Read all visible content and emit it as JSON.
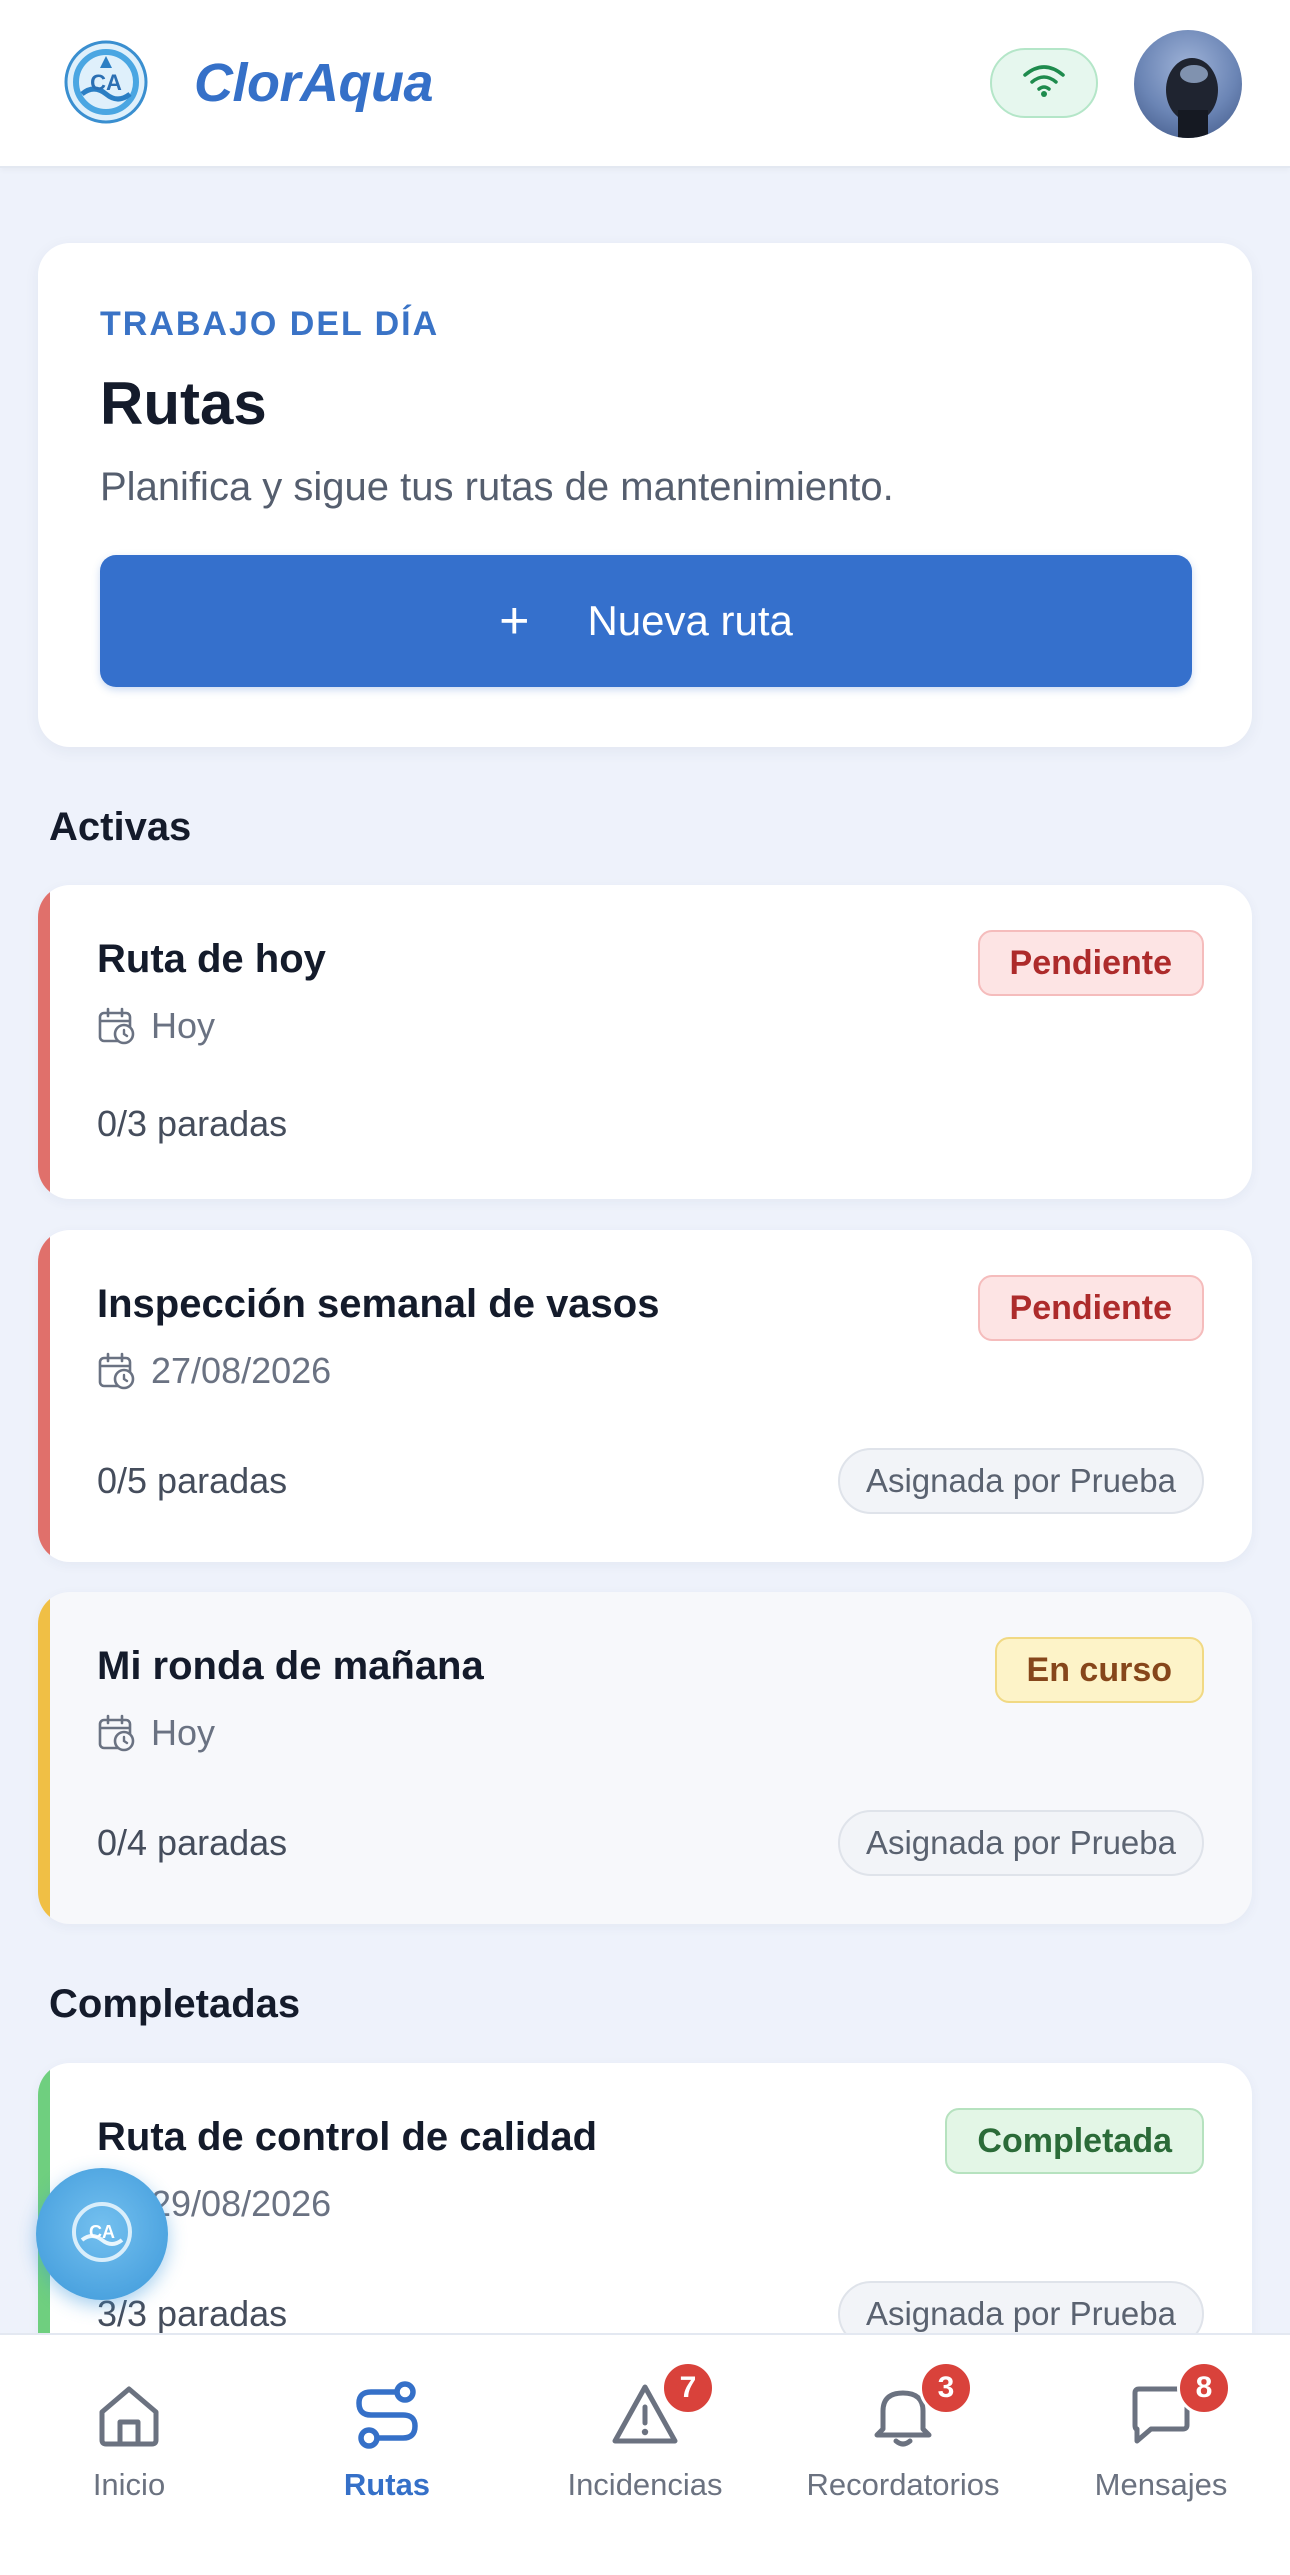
{
  "header": {
    "brand": "ClorAqua",
    "logo_icon": "cloraqua-logo-icon",
    "status_icon": "wifi-icon",
    "status_color": "#1e8b4d"
  },
  "hero": {
    "eyebrow": "TRABAJO DEL DÍA",
    "title": "Rutas",
    "subtitle": "Planifica y sigue tus rutas de mantenimiento.",
    "new_button": {
      "icon": "+",
      "label": "Nueva ruta"
    }
  },
  "sections": {
    "active": "Activas",
    "completed": "Completadas"
  },
  "routes": [
    {
      "title": "Ruta de hoy",
      "date": "Hoy",
      "stops": "0/3 paradas",
      "status": "Pendiente",
      "assigned": "",
      "accent": "#e0706b"
    },
    {
      "title": "Inspección semanal de vasos",
      "date": "27/08/2026",
      "stops": "0/5 paradas",
      "status": "Pendiente",
      "assigned": "Asignada por Prueba",
      "accent": "#e0706b"
    },
    {
      "title": "Mi ronda de mañana",
      "date": "Hoy",
      "stops": "0/4 paradas",
      "status": "En curso",
      "assigned": "Asignada por Prueba",
      "accent": "#f0bf45"
    },
    {
      "title": "Ruta de control de calidad",
      "date": "29/08/2026",
      "stops": "3/3 paradas",
      "status": "Completada",
      "assigned": "Asignada por Prueba",
      "accent": "#6fcf7f"
    }
  ],
  "nav": [
    {
      "label": "Inicio",
      "icon": "home-icon",
      "badge": ""
    },
    {
      "label": "Rutas",
      "icon": "route-icon",
      "badge": "",
      "active": true
    },
    {
      "label": "Incidencias",
      "icon": "warning-icon",
      "badge": "7"
    },
    {
      "label": "Recordatorios",
      "icon": "bell-icon",
      "badge": "3"
    },
    {
      "label": "Mensajes",
      "icon": "chat-icon",
      "badge": "8"
    }
  ],
  "colors": {
    "primary": "#3570c8",
    "background": "#eef2fb",
    "badge_red": "#d9423b"
  }
}
